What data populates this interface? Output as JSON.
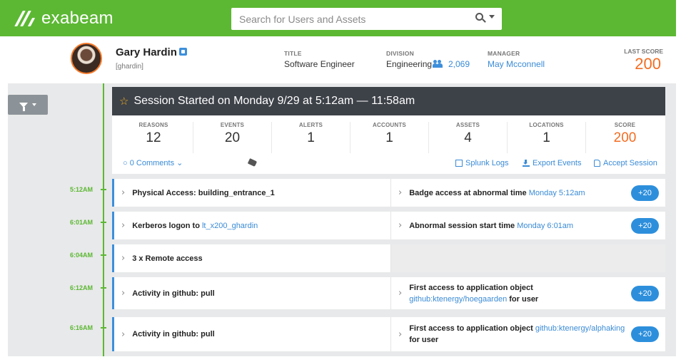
{
  "app": {
    "logo_text": "exabeam",
    "accent": "#5cb833"
  },
  "search": {
    "placeholder": "Search for Users and Assets"
  },
  "user": {
    "name": "Gary Hardin",
    "handle": "[ghardin]",
    "title_label": "TITLE",
    "title": "Software Engineer",
    "division_label": "DIVISION",
    "division": "Engineering",
    "division_count": "2,069",
    "manager_label": "MANAGER",
    "manager": "May Mcconnell",
    "last_score_label": "LAST SCORE",
    "last_score": "200"
  },
  "session": {
    "title": "Session Started on Monday 9/29 at 5:12am — 11:58am",
    "stats": [
      {
        "label": "REASONS",
        "value": "12"
      },
      {
        "label": "EVENTS",
        "value": "20"
      },
      {
        "label": "ALERTS",
        "value": "1"
      },
      {
        "label": "ACCOUNTS",
        "value": "1"
      },
      {
        "label": "ASSETS",
        "value": "4"
      },
      {
        "label": "LOCATIONS",
        "value": "1"
      },
      {
        "label": "SCORE",
        "value": "200"
      }
    ],
    "comments": "0 Comments",
    "actions": {
      "splunk": "Splunk Logs",
      "export": "Export Events",
      "accept": "Accept Session"
    }
  },
  "timeline": [
    {
      "time": "5:12AM",
      "left": "Physical Access: building_entrance_1",
      "right_text": "Badge access at abnormal time ",
      "right_link": "Monday 5:12am",
      "badge": "+20"
    },
    {
      "time": "6:01AM",
      "left_text": "Kerberos logon to ",
      "left_link": "lt_x200_ghardin",
      "right_text": "Abnormal session start time ",
      "right_link": "Monday 6:01am",
      "badge": "+20"
    },
    {
      "time": "6:04AM",
      "left": "3 x Remote access"
    },
    {
      "time": "6:12AM",
      "left": "Activity in github: pull",
      "right_line1": "First access to application object",
      "right_link": "github:ktenergy/hoegaarden",
      "right_suffix": " for user",
      "badge": "+20"
    },
    {
      "time": "6:16AM",
      "left": "Activity in github: pull",
      "right_text": "First access to application object ",
      "right_link": "github:ktenergy/alphaking",
      "right_line2": "for user",
      "badge": "+20"
    }
  ]
}
